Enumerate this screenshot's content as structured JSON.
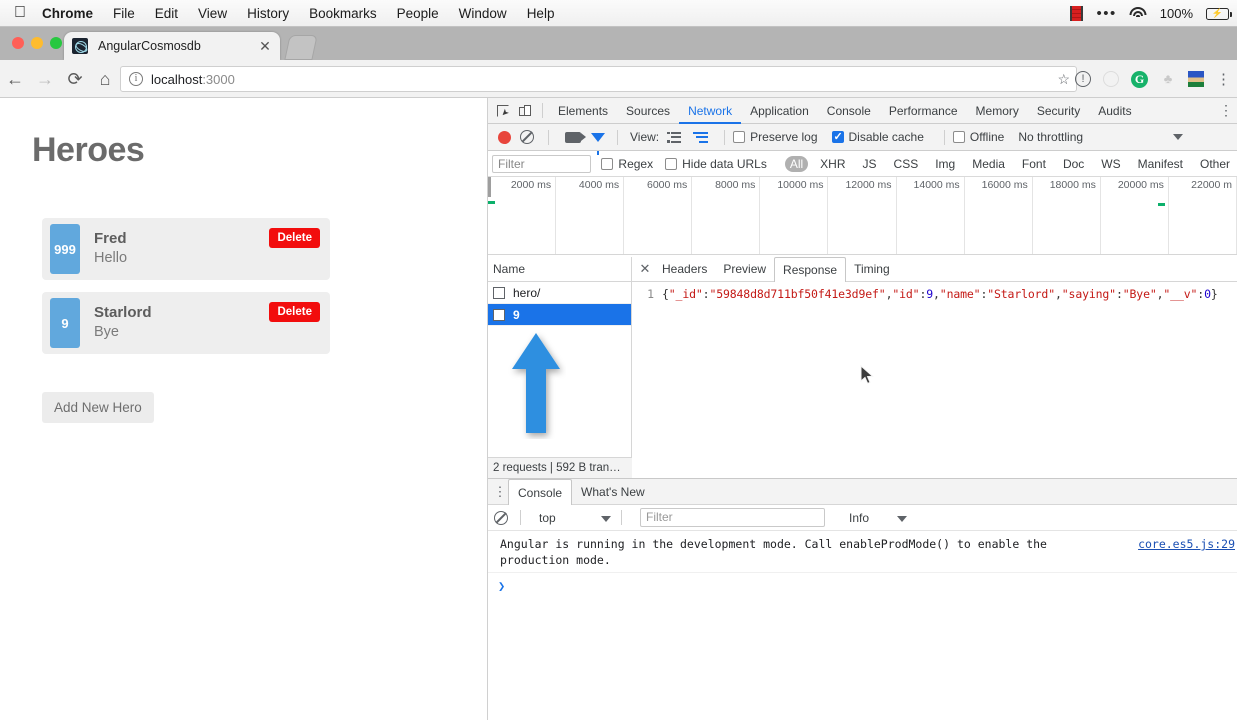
{
  "macbar": {
    "apple_icon": "apple-icon",
    "menus": [
      "Chrome",
      "File",
      "Edit",
      "View",
      "History",
      "Bookmarks",
      "People",
      "Window",
      "Help"
    ],
    "status": {
      "recording_icon": "screen-recording-icon",
      "overflow_icon": "menu-overflow-icon",
      "wifi_icon": "wifi-icon",
      "battery_percent": "100%",
      "battery_icon": "battery-charging-icon"
    }
  },
  "browser": {
    "tab": {
      "title": "AngularCosmosdb",
      "favicon": "app-favicon",
      "close_icon": "close-icon"
    },
    "new_tab_icon": "new-tab-icon",
    "nav": {
      "back_icon": "back-arrow-icon",
      "forward_icon": "forward-arrow-icon",
      "reload_icon": "reload-icon",
      "home_icon": "home-icon"
    },
    "omnibox": {
      "info_icon": "page-info-icon",
      "url_host": "localhost",
      "url_port": ":3000",
      "bookmark_icon": "star-icon"
    },
    "extensions": [
      "exclamation-circle-icon",
      "faded-circle-icon",
      "grammarly-icon",
      "tree-icon",
      "profile-avatar-icon",
      "chrome-menu-icon"
    ]
  },
  "app": {
    "title": "Heroes",
    "heroes": [
      {
        "id": "999",
        "name": "Fred",
        "saying": "Hello",
        "delete_label": "Delete"
      },
      {
        "id": "9",
        "name": "Starlord",
        "saying": "Bye",
        "delete_label": "Delete"
      }
    ],
    "add_button": "Add New Hero",
    "badge_color": "#61a8dd",
    "delete_color": "#f20d0d"
  },
  "devtools": {
    "icons": {
      "inspect": "inspect-element-icon",
      "device": "device-toolbar-icon",
      "more": "devtools-more-icon"
    },
    "panels": [
      "Elements",
      "Sources",
      "Network",
      "Application",
      "Console",
      "Performance",
      "Memory",
      "Security",
      "Audits"
    ],
    "active_panel": "Network",
    "network_toolbar": {
      "record_icon": "record-button-icon",
      "clear_icon": "clear-icon",
      "capture_screenshots_icon": "camera-icon",
      "filter_icon": "filter-funnel-icon",
      "view_label": "View:",
      "view_list_icon": "list-view-icon",
      "view_waterfall_icon": "waterfall-view-icon",
      "preserve_log": {
        "label": "Preserve log",
        "checked": false
      },
      "disable_cache": {
        "label": "Disable cache",
        "checked": true
      },
      "offline": {
        "label": "Offline",
        "checked": false
      },
      "throttling": "No throttling",
      "throttling_caret": "chevron-down-icon"
    },
    "filter_bar": {
      "placeholder": "Filter",
      "regex": {
        "label": "Regex",
        "checked": false
      },
      "hide_data_urls": {
        "label": "Hide data URLs",
        "checked": false
      },
      "types": [
        "All",
        "XHR",
        "JS",
        "CSS",
        "Img",
        "Media",
        "Font",
        "Doc",
        "WS",
        "Manifest",
        "Other"
      ],
      "active_type": "All"
    },
    "timeline": {
      "ticks": [
        "2000 ms",
        "4000 ms",
        "6000 ms",
        "8000 ms",
        "10000 ms",
        "12000 ms",
        "14000 ms",
        "16000 ms",
        "18000 ms",
        "20000 ms",
        "22000 m"
      ],
      "marker_color": "#0cb06b"
    },
    "requests": {
      "column_header": "Name",
      "rows": [
        {
          "name": "hero/",
          "selected": false
        },
        {
          "name": "9",
          "selected": true
        }
      ],
      "footer": "2 requests | 592 B tran…",
      "annotation_arrow": "blue-up-arrow-annotation"
    },
    "detail": {
      "close_icon": "close-icon",
      "tabs": [
        "Headers",
        "Preview",
        "Response",
        "Timing"
      ],
      "active_tab": "Response",
      "line_number": "1",
      "response_body": "{\"_id\":\"59848d8d711bf50f41e3d9ef\",\"id\":9,\"name\":\"Starlord\",\"saying\":\"Bye\",\"__v\":0}",
      "tokens": {
        "open_brace": "{",
        "k_id": "\"_id\"",
        "v_id": "\"59848d8d711bf50f41e3d9ef\"",
        "k_id2": "\"id\"",
        "v_id2": "9",
        "k_name": "\"name\"",
        "v_name": "\"Starlord\"",
        "k_saying": "\"saying\"",
        "v_saying": "\"Bye\"",
        "k_v": "\"__v\"",
        "v_v": "0",
        "close_brace": "}"
      },
      "mouse_cursor": "mouse-pointer-icon"
    },
    "drawer": {
      "more_icon": "drawer-more-icon",
      "tabs": [
        "Console",
        "What's New"
      ],
      "active_tab": "Console",
      "toolbar": {
        "clear_icon": "clear-console-icon",
        "context": "top",
        "context_caret": "chevron-down-icon",
        "filter_placeholder": "Filter",
        "level": "Info",
        "level_caret": "chevron-down-icon"
      },
      "messages": [
        {
          "text": "Angular is running in the development mode. Call enableProdMode() to enable the production mode.",
          "source": "core.es5.js:29"
        }
      ],
      "prompt_icon": "console-prompt-caret"
    }
  }
}
